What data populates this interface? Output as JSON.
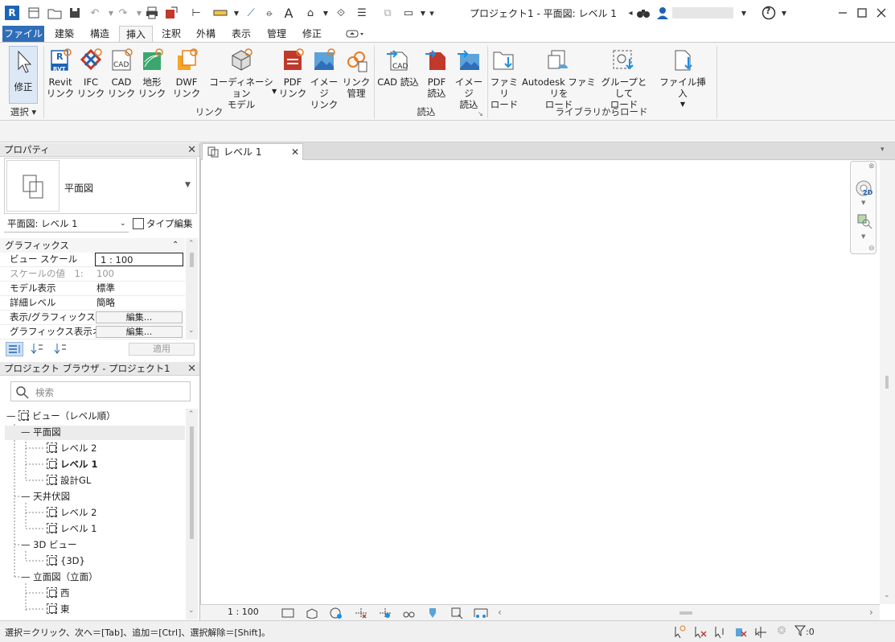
{
  "window": {
    "title": "プロジェクト1 - 平面図: レベル 1",
    "app_badge": "R",
    "help_icon": "?"
  },
  "ribbon_tabs": [
    "ファイル",
    "建築",
    "構造",
    "挿入",
    "注釈",
    "外構",
    "表示",
    "管理",
    "修正"
  ],
  "ribbon": {
    "select": {
      "label": "修正",
      "group": "選択"
    },
    "link_group": {
      "label": "リンク",
      "buttons": [
        {
          "line1": "Revit",
          "line2": "リンク"
        },
        {
          "line1": "IFC",
          "line2": "リンク"
        },
        {
          "line1": "CAD",
          "line2": "リンク"
        },
        {
          "line1": "地形",
          "line2": "リンク"
        },
        {
          "line1": "DWF",
          "line2": "リンク"
        },
        {
          "line1": "コーディネーション",
          "line2": "モデル"
        },
        {
          "line1": "PDF",
          "line2": "リンク"
        },
        {
          "line1": "イメージ",
          "line2": "リンク"
        },
        {
          "line1": "リンク",
          "line2": "管理"
        }
      ]
    },
    "import_group": {
      "label": "読込",
      "buttons": [
        {
          "line1": "CAD 読込",
          "line2": ""
        },
        {
          "line1": "PDF",
          "line2": "読込"
        },
        {
          "line1": "イメージ",
          "line2": "読込"
        }
      ]
    },
    "library_group": {
      "label": "ライブラリからロード",
      "buttons": [
        {
          "line1": "ファミリ",
          "line2": "ロード"
        },
        {
          "line1": "Autodesk ファミリを",
          "line2": "ロード"
        },
        {
          "line1": "グループとして",
          "line2": "ロード"
        },
        {
          "line1": "ファイル挿入",
          "line2": ""
        }
      ]
    },
    "icon_labels": {
      "cad": "CAD",
      "revit": "R",
      "rvt": "RVT",
      "ifc": "IFC"
    }
  },
  "properties": {
    "panel_title": "プロパティ",
    "type_name": "平面図",
    "selector": "平面図: レベル 1",
    "type_edit": "タイプ編集",
    "section": "グラフィックス",
    "rows": [
      {
        "key": "ビュー スケール",
        "value": "1 : 100"
      },
      {
        "key": "スケールの値　1:",
        "value": "100"
      },
      {
        "key": "モデル表示",
        "value": "標準"
      },
      {
        "key": "詳細レベル",
        "value": "簡略"
      },
      {
        "key": "表示/グラフィックス...",
        "value": "編集..."
      },
      {
        "key": "グラフィックス表示オ...",
        "value": "編集..."
      }
    ],
    "apply": "適用"
  },
  "browser": {
    "panel_title": "プロジェクト ブラウザ - プロジェクト1",
    "search_placeholder": "検索",
    "root": "ビュー（レベル順）",
    "groups": {
      "floor_plan": "平面図",
      "ceiling": "天井伏図",
      "view3d": "3D ビュー",
      "elevation": "立面図（立面）"
    },
    "items": {
      "fp_l2": "レベル 2",
      "fp_l1": "レベル 1",
      "fp_gl": "設計GL",
      "cp_l2": "レベル 2",
      "cp_l1": "レベル 1",
      "v3d": "{3D}",
      "el_w": "西",
      "el_e": "東"
    }
  },
  "view_tab": {
    "label": "レベル 1"
  },
  "view_control": {
    "scale": "1 : 100"
  },
  "navbar": {
    "badge": "2D"
  },
  "status": {
    "hint": "選択＝クリック、次へ＝[Tab]、追加＝[Ctrl]、選択解除＝[Shift]。",
    "filter_count": ":0"
  }
}
